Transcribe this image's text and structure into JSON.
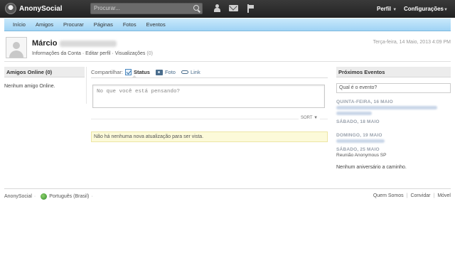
{
  "topbar": {
    "app_name": "AnonySocial",
    "search_placeholder": "Procurar...",
    "perfil_label": "Perfil",
    "config_label": "Configurações",
    "caret": "▼"
  },
  "nav": {
    "items": [
      "Início",
      "Amigos",
      "Procurar",
      "Páginas",
      "Fotos",
      "Eventos"
    ]
  },
  "profile": {
    "name": "Márcio",
    "account_info": "Informações da Conta",
    "edit_profile": "Editar perfil",
    "views_label": "Visualizações",
    "views_count": "(0)",
    "timestamp": "Terça-feira, 14 Maio, 2013 4:09 PM"
  },
  "left": {
    "title": "Amigos Online (0)",
    "empty": "Nenhum amigo Online."
  },
  "share": {
    "label": "Compartilhar:",
    "status": "Status",
    "photo": "Foto",
    "link": "Link",
    "placeholder": "No que você está pensando?",
    "sort": "SORT ▼",
    "notice": "Não há nenhuma nova atualização para ser vista."
  },
  "events": {
    "title": "Próximos Eventos",
    "prompt": "Qual é o evento?",
    "items": [
      {
        "date": "QUINTA-FEIRA, 16 MAIO"
      },
      {
        "date": "SÁBADO, 18 MAIO"
      },
      {
        "date": "DOMINGO, 19 MAIO"
      },
      {
        "date": "SÁBADO, 25 MAIO",
        "name": "Reunião Anonymous SP"
      }
    ],
    "no_birthday": "Nenhum aniversário a caminho."
  },
  "footer": {
    "brand": "AnonySocial",
    "language": "Português (Brasil)",
    "links": [
      "Quem Somos",
      "Convidar",
      "Móvel"
    ]
  }
}
